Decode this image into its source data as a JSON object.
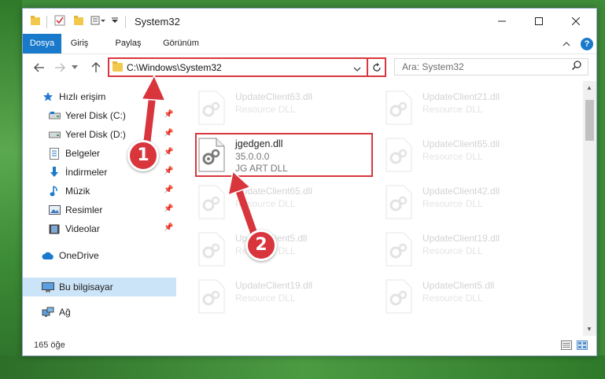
{
  "window": {
    "title": "System32"
  },
  "ribbon": {
    "tabs": [
      "Dosya",
      "Giriş",
      "Paylaş",
      "Görünüm"
    ],
    "help": "?"
  },
  "address": {
    "path": "C:\\Windows\\System32"
  },
  "search": {
    "placeholder": "Ara: System32"
  },
  "nav": {
    "items": [
      {
        "label": "Hızlı erişim",
        "icon": "star-icon"
      },
      {
        "label": "Yerel Disk (C:)",
        "icon": "drive-icon"
      },
      {
        "label": "Yerel Disk (D:)",
        "icon": "drive-icon"
      },
      {
        "label": "Belgeler",
        "icon": "documents-icon"
      },
      {
        "label": "İndirmeler",
        "icon": "download-icon"
      },
      {
        "label": "Müzik",
        "icon": "music-icon"
      },
      {
        "label": "Resimler",
        "icon": "pictures-icon"
      },
      {
        "label": "Videolar",
        "icon": "video-icon"
      },
      {
        "label": "OneDrive",
        "icon": "cloud-icon"
      },
      {
        "label": "Bu bilgisayar",
        "icon": "computer-icon"
      },
      {
        "label": "Ağ",
        "icon": "network-icon"
      }
    ]
  },
  "files": {
    "left": [
      {
        "name": "UpdateClient63.dll",
        "sub1": "Resource DLL"
      },
      {
        "name": "jgedgen.dll",
        "sub1": "35.0.0.0",
        "sub2": "JG ART DLL"
      },
      {
        "name": "UpdateClient65.dll",
        "sub1": "Resource DLL"
      },
      {
        "name": "UpdateClient5.dll",
        "sub1": "Resource DLL"
      },
      {
        "name": "UpdateClient19.dll",
        "sub1": "Resource DLL"
      }
    ],
    "right": [
      {
        "name": "UpdateClient21.dll",
        "sub1": "Resource DLL"
      },
      {
        "name": "UpdateClient65.dll",
        "sub1": "Resource DLL"
      },
      {
        "name": "UpdateClient42.dll",
        "sub1": "Resource DLL"
      },
      {
        "name": "UpdateClient19.dll",
        "sub1": "Resource DLL"
      },
      {
        "name": "UpdateClient5.dll",
        "sub1": "Resource DLL"
      }
    ]
  },
  "status": {
    "count": "165 öğe"
  },
  "badges": {
    "one": "1",
    "two": "2"
  },
  "colors": {
    "accent": "#1979ca",
    "highlight": "#d9363e",
    "badge": "#d8353d"
  }
}
